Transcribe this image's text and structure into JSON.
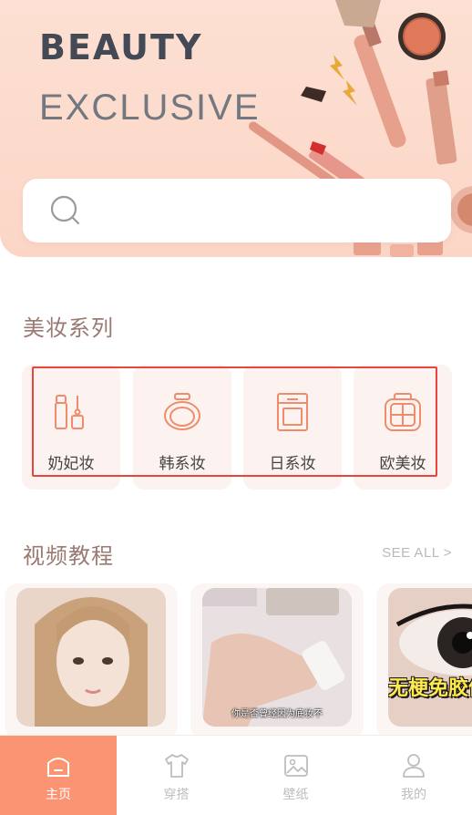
{
  "header": {
    "title": "BEAUTY",
    "subtitle": "EXCLUSIVE"
  },
  "search": {
    "placeholder": "",
    "value": ""
  },
  "makeup_series": {
    "title": "美妆系列",
    "categories": [
      {
        "label": "奶妃妆",
        "icon": "lip-gloss-icon"
      },
      {
        "label": "韩系妆",
        "icon": "compact-mirror-icon"
      },
      {
        "label": "日系妆",
        "icon": "powder-palette-icon"
      },
      {
        "label": "欧美妆",
        "icon": "eyeshadow-palette-icon"
      }
    ],
    "highlight_color": "#e8453c"
  },
  "video_tutorials": {
    "title": "视频教程",
    "see_all": "SEE ALL >",
    "videos": [
      {
        "thumb": "girl-portrait",
        "caption": ""
      },
      {
        "thumb": "hand-with-product",
        "caption": "你是否曾经因为底妆不"
      },
      {
        "thumb": "eye-closeup",
        "caption": "无梗免胶仙"
      }
    ]
  },
  "bottom_nav": {
    "items": [
      {
        "label": "主页",
        "icon": "home-icon",
        "active": true
      },
      {
        "label": "穿搭",
        "icon": "tshirt-icon",
        "active": false
      },
      {
        "label": "壁纸",
        "icon": "wallpaper-icon",
        "active": false
      },
      {
        "label": "我的",
        "icon": "profile-icon",
        "active": false
      }
    ],
    "active_color": "#fb9473"
  },
  "colors": {
    "accent": "#fb9473",
    "header_bg": "#fde0d3",
    "card_bg": "#fcf3f0",
    "section_title": "#9a7a72"
  }
}
